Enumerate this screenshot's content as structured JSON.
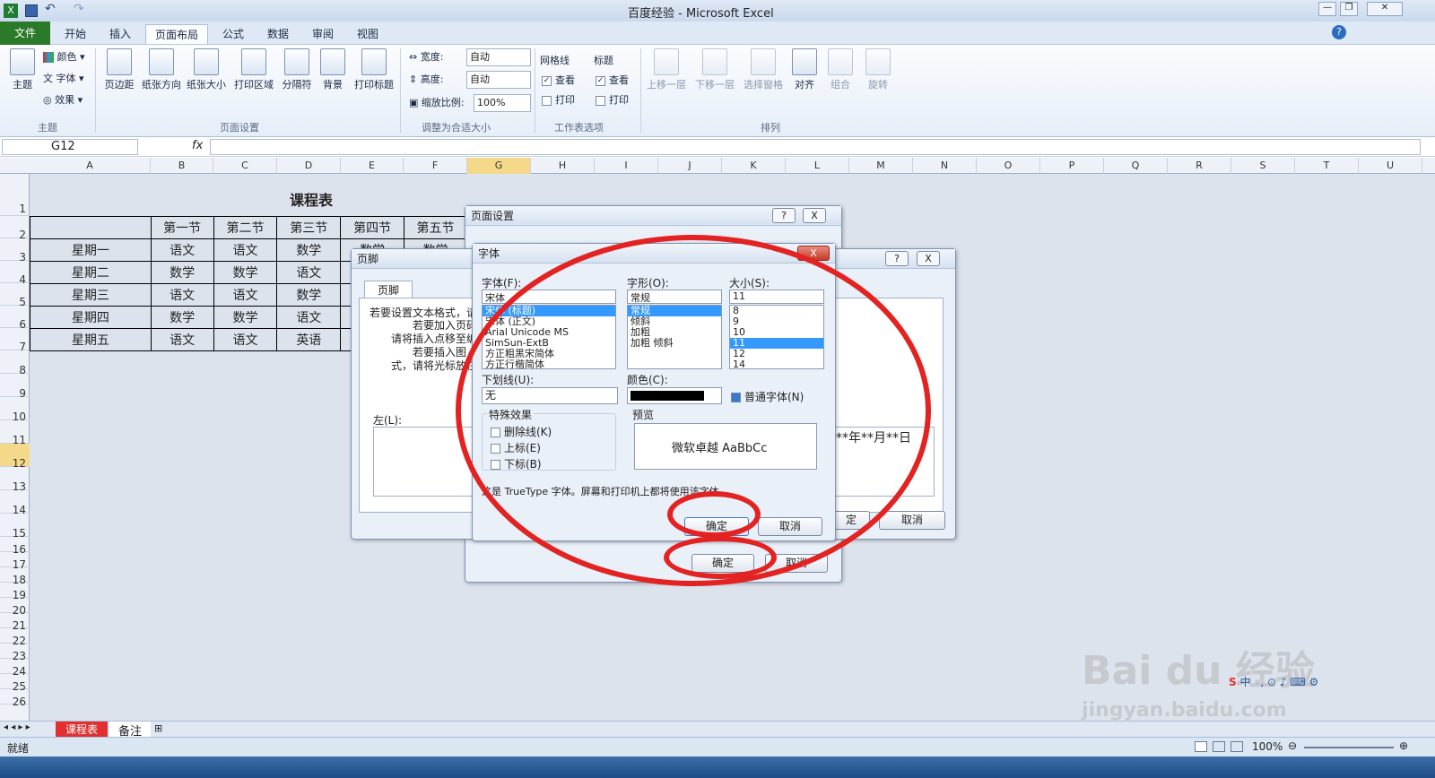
{
  "window": {
    "title": "百度经验 - Microsoft Excel"
  },
  "ribbon": {
    "tabs": [
      "文件",
      "开始",
      "插入",
      "页面布局",
      "公式",
      "数据",
      "审阅",
      "视图"
    ],
    "theme": {
      "main": "主题",
      "items": [
        "颜色",
        "字体",
        "效果"
      ],
      "group": "主题"
    },
    "page_setup": {
      "buttons": [
        "页边距",
        "纸张方向",
        "纸张大小",
        "打印区域",
        "分隔符",
        "背景",
        "打印标题"
      ],
      "group": "页面设置"
    },
    "scale": {
      "width_label": "宽度:",
      "width_value": "自动",
      "height_label": "高度:",
      "height_value": "自动",
      "scale_label": "缩放比例:",
      "scale_value": "100%",
      "group": "调整为合适大小"
    },
    "sheet_opts": {
      "gridlines": "网格线",
      "headings": "标题",
      "view": "查看",
      "print": "打印",
      "group": "工作表选项"
    },
    "arrange": {
      "buttons": [
        "上移一层",
        "下移一层",
        "选择窗格",
        "对齐",
        "组合",
        "旋转"
      ],
      "group": "排列"
    }
  },
  "formula_bar": {
    "cell": "G12",
    "fx": "fx"
  },
  "columns": [
    "A",
    "B",
    "C",
    "D",
    "E",
    "F",
    "G",
    "H",
    "I",
    "J",
    "K",
    "L",
    "M",
    "N",
    "O",
    "P",
    "Q",
    "R",
    "S",
    "T",
    "U"
  ],
  "rows": [
    "1",
    "2",
    "3",
    "4",
    "5",
    "6",
    "7",
    "8",
    "9",
    "10",
    "11",
    "12",
    "13",
    "14",
    "15",
    "16",
    "17",
    "18",
    "19",
    "20",
    "21",
    "22",
    "23",
    "24",
    "25",
    "26"
  ],
  "sheet": {
    "title": "课程表",
    "header": [
      "",
      "第一节",
      "第二节",
      "第三节",
      "第四节",
      "第五节"
    ],
    "rows": [
      [
        "星期一",
        "语文",
        "语文",
        "数学",
        "数学",
        "数学"
      ],
      [
        "星期二",
        "数学",
        "数学",
        "语文",
        "",
        ""
      ],
      [
        "星期三",
        "语文",
        "语文",
        "数学",
        "",
        ""
      ],
      [
        "星期四",
        "数学",
        "数学",
        "语文",
        "",
        ""
      ],
      [
        "星期五",
        "语文",
        "语文",
        "英语",
        "",
        ""
      ]
    ]
  },
  "sheet_tabs": [
    "课程表",
    "备注"
  ],
  "status": {
    "ready": "就绪",
    "zoom": "100%"
  },
  "dlg_pagesetup": {
    "title": "页面设置",
    "help": "?",
    "close": "X",
    "ok": "确定",
    "cancel": "取消"
  },
  "dlg_footer": {
    "title": "页脚",
    "tab": "页脚",
    "lines": [
      "若要设置文本格式，请",
      "若要加入页码",
      "请将插入点移至编",
      "若要插入图",
      "式，请将光标放在"
    ],
    "left_label": "左(L):",
    "right_text": "**年**月**日",
    "ok": "定",
    "cancel": "取消",
    "help": "?",
    "close": "X"
  },
  "dlg_font": {
    "title": "字体",
    "font_label": "字体(F):",
    "font_value": "宋体",
    "fonts": [
      "宋体 (标题)",
      "宋体 (正文)",
      "Arial Unicode MS",
      "SimSun-ExtB",
      "方正粗黑宋简体",
      "方正行楷简体"
    ],
    "style_label": "字形(O):",
    "style_value": "常规",
    "styles": [
      "常规",
      "倾斜",
      "加粗",
      "加粗 倾斜"
    ],
    "size_label": "大小(S):",
    "size_value": "11",
    "sizes": [
      "8",
      "9",
      "10",
      "11",
      "12",
      "14"
    ],
    "underline_label": "下划线(U):",
    "underline_value": "无",
    "color_label": "颜色(C):",
    "normal_font": "普通字体(N)",
    "effects_label": "特殊效果",
    "effects": [
      "删除线(K)",
      "上标(E)",
      "下标(B)"
    ],
    "preview_label": "预览",
    "preview_text": "微软卓越  AaBbCc",
    "note": "这是 TrueType 字体。屏幕和打印机上都将使用该字体",
    "ok": "确定",
    "cancel": "取消",
    "close": "X"
  },
  "watermark": {
    "logo": "Bai du 经验",
    "url": "jingyan.baidu.com"
  },
  "ime": "中"
}
